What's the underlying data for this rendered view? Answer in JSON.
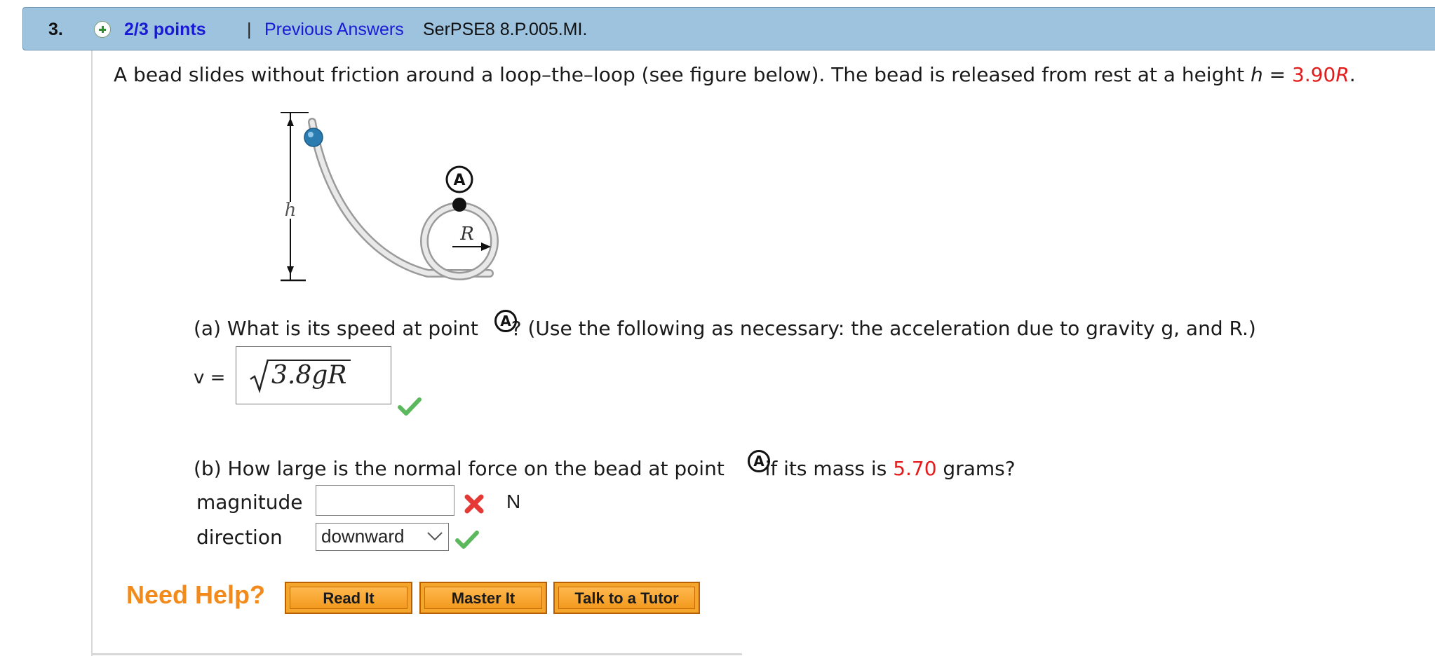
{
  "header": {
    "question_number": "3.",
    "points": "2/3 points",
    "separator": "|",
    "previous_answers": "Previous Answers",
    "question_id": "SerPSE8 8.P.005.MI."
  },
  "problem": {
    "intro_before_h": "A bead slides without friction around a loop–the–loop (see figure below). The bead is released from rest at a height ",
    "h_symbol": "h",
    "equals": " = ",
    "h_value": "3.90",
    "R_symbol": "R",
    "period": "."
  },
  "figure": {
    "label_A": "A",
    "label_h": "h",
    "label_R": "R"
  },
  "part_a": {
    "question_before": "(a) What is its speed at point ",
    "point_label": "A",
    "question_after": "? (Use the following as necessary: the acceleration due to gravity g, and R.)",
    "var_label": "v =",
    "answer": "3.8gR",
    "status": "correct"
  },
  "part_b": {
    "question_before": "(b) How large is the normal force on the bead at point ",
    "point_label": "A",
    "question_mid": " if its mass is ",
    "mass_value": "5.70",
    "question_after": " grams?",
    "magnitude_label": "magnitude",
    "magnitude_value": "",
    "magnitude_status": "incorrect",
    "unit": "N",
    "direction_label": "direction",
    "direction_value": "downward",
    "direction_status": "correct"
  },
  "help": {
    "label": "Need Help?",
    "buttons": [
      "Read It",
      "Master It",
      "Talk to a Tutor"
    ]
  },
  "colors": {
    "header_bg": "#9ec3df",
    "link": "#1a1ad6",
    "given_value": "#e31b1b",
    "help_orange": "#f28a1c",
    "correct": "#5cb85c",
    "incorrect": "#e53935"
  }
}
